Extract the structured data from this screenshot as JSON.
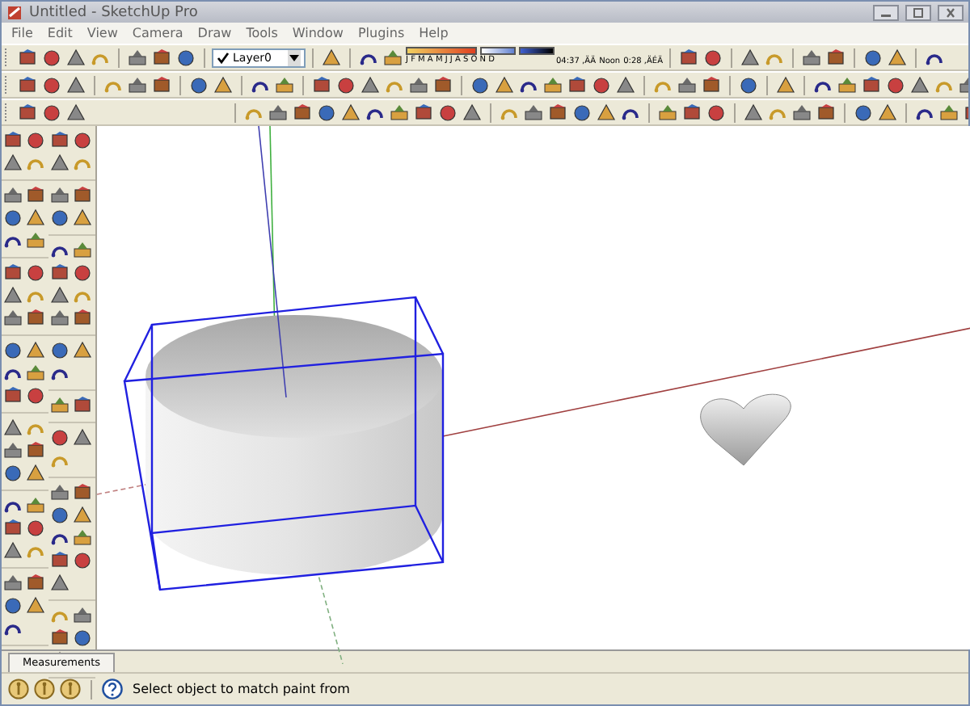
{
  "window": {
    "title": "Untitled - SketchUp Pro"
  },
  "menu": [
    "File",
    "Edit",
    "View",
    "Camera",
    "Draw",
    "Tools",
    "Window",
    "Plugins",
    "Help"
  ],
  "layers": {
    "value": "Layer0"
  },
  "shadows": {
    "months": "J F M A M J J A S O N D",
    "time_start": "04:37 ,ÄÄ",
    "time_mid": "Noon",
    "time_end": "0:28 ,ÄÉÄ"
  },
  "measurements": {
    "label": "Measurements"
  },
  "status_bar": {
    "message": "Select object to match paint from"
  }
}
